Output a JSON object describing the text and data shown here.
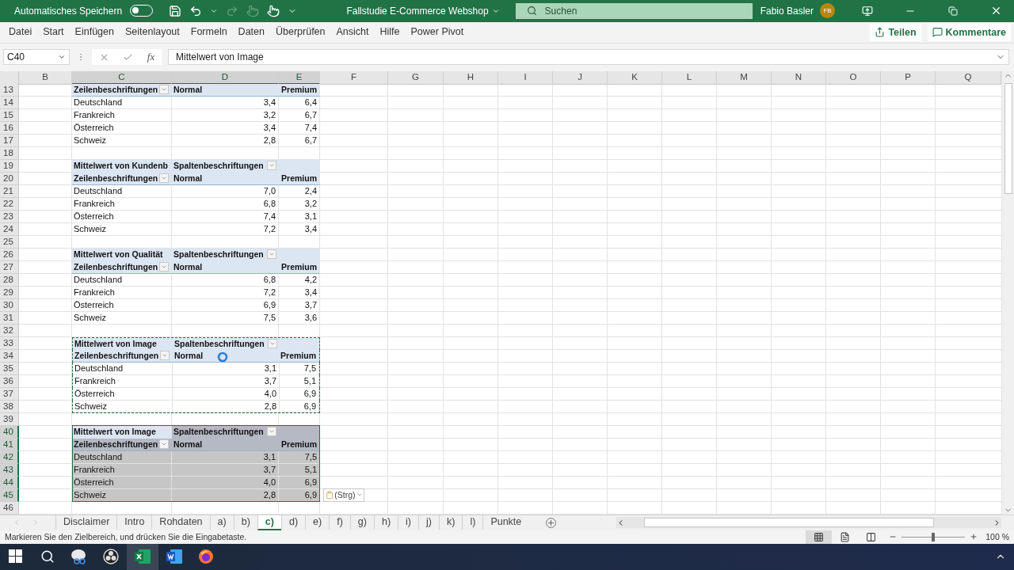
{
  "title_bar": {
    "autosave_label": "Automatisches Speichern",
    "autosave_on": false,
    "document_title": "Fallstudie E-Commerce Webshop",
    "search": {
      "placeholder": "Suchen"
    },
    "user_name": "Fabio Basler",
    "user_initials": "FB"
  },
  "ribbon_tabs": [
    {
      "label": "Datei",
      "selected": false
    },
    {
      "label": "Start",
      "selected": false
    },
    {
      "label": "Einfügen",
      "selected": false
    },
    {
      "label": "Seitenlayout",
      "selected": false
    },
    {
      "label": "Formeln",
      "selected": false
    },
    {
      "label": "Daten",
      "selected": false
    },
    {
      "label": "Überprüfen",
      "selected": false
    },
    {
      "label": "Ansicht",
      "selected": false
    },
    {
      "label": "Hilfe",
      "selected": false
    },
    {
      "label": "Power Pivot",
      "selected": false
    }
  ],
  "ribbon_buttons": [
    {
      "label": "Teilen",
      "kind": "share"
    },
    {
      "label": "Kommentare",
      "kind": "comments"
    }
  ],
  "formula_bar": {
    "name_box": "C40",
    "function_label": "fx",
    "formula": "Mittelwert von Image"
  },
  "columns": [
    {
      "label": "B",
      "selected": false
    },
    {
      "label": "C",
      "selected": true
    },
    {
      "label": "D",
      "selected": true
    },
    {
      "label": "E",
      "selected": true
    },
    {
      "label": "F",
      "selected": false
    },
    {
      "label": "G",
      "selected": false
    },
    {
      "label": "H",
      "selected": false
    },
    {
      "label": "I",
      "selected": false
    },
    {
      "label": "J",
      "selected": false
    },
    {
      "label": "K",
      "selected": false
    },
    {
      "label": "L",
      "selected": false
    },
    {
      "label": "M",
      "selected": false
    },
    {
      "label": "N",
      "selected": false
    },
    {
      "label": "O",
      "selected": false
    },
    {
      "label": "P",
      "selected": false
    },
    {
      "label": "Q",
      "selected": false
    }
  ],
  "rows": [
    {
      "number": "13",
      "kind": "header",
      "cells": [
        "Zeilenbeschriftungen",
        "Normal",
        "Premium"
      ],
      "copied": false,
      "selected": false,
      "active": false
    },
    {
      "number": "14",
      "kind": "data",
      "cells": [
        "Deutschland",
        "3,4",
        "6,4"
      ],
      "copied": false,
      "selected": false,
      "active": false
    },
    {
      "number": "15",
      "kind": "data",
      "cells": [
        "Frankreich",
        "3,2",
        "6,7"
      ],
      "copied": false,
      "selected": false,
      "active": false
    },
    {
      "number": "16",
      "kind": "data",
      "cells": [
        "Österreich",
        "3,4",
        "7,4"
      ],
      "copied": false,
      "selected": false,
      "active": false
    },
    {
      "number": "17",
      "kind": "data",
      "cells": [
        "Schweiz",
        "2,8",
        "6,7"
      ],
      "copied": false,
      "selected": false,
      "active": false
    },
    {
      "number": "18",
      "kind": "blank",
      "copied": false,
      "selected": false,
      "active": false
    },
    {
      "number": "19",
      "kind": "title",
      "cells": [
        "Mittelwert von Kundenb",
        "Spaltenbeschriftungen"
      ],
      "copied": false,
      "selected": false,
      "active": false
    },
    {
      "number": "20",
      "kind": "header",
      "cells": [
        "Zeilenbeschriftungen",
        "Normal",
        "Premium"
      ],
      "copied": false,
      "selected": false,
      "active": false
    },
    {
      "number": "21",
      "kind": "data",
      "cells": [
        "Deutschland",
        "7,0",
        "2,4"
      ],
      "copied": false,
      "selected": false,
      "active": false
    },
    {
      "number": "22",
      "kind": "data",
      "cells": [
        "Frankreich",
        "6,8",
        "3,2"
      ],
      "copied": false,
      "selected": false,
      "active": false
    },
    {
      "number": "23",
      "kind": "data",
      "cells": [
        "Österreich",
        "7,4",
        "3,1"
      ],
      "copied": false,
      "selected": false,
      "active": false
    },
    {
      "number": "24",
      "kind": "data",
      "cells": [
        "Schweiz",
        "7,2",
        "3,4"
      ],
      "copied": false,
      "selected": false,
      "active": false
    },
    {
      "number": "25",
      "kind": "blank",
      "copied": false,
      "selected": false,
      "active": false
    },
    {
      "number": "26",
      "kind": "title",
      "cells": [
        "Mittelwert von Qualität",
        "Spaltenbeschriftungen"
      ],
      "copied": false,
      "selected": false,
      "active": false
    },
    {
      "number": "27",
      "kind": "header",
      "cells": [
        "Zeilenbeschriftungen",
        "Normal",
        "Premium"
      ],
      "copied": false,
      "selected": false,
      "active": false
    },
    {
      "number": "28",
      "kind": "data",
      "cells": [
        "Deutschland",
        "6,8",
        "4,2"
      ],
      "copied": false,
      "selected": false,
      "active": false
    },
    {
      "number": "29",
      "kind": "data",
      "cells": [
        "Frankreich",
        "7,2",
        "3,4"
      ],
      "copied": false,
      "selected": false,
      "active": false
    },
    {
      "number": "30",
      "kind": "data",
      "cells": [
        "Österreich",
        "6,9",
        "3,7"
      ],
      "copied": false,
      "selected": false,
      "active": false
    },
    {
      "number": "31",
      "kind": "data",
      "cells": [
        "Schweiz",
        "7,5",
        "3,6"
      ],
      "copied": false,
      "selected": false,
      "active": false
    },
    {
      "number": "32",
      "kind": "blank",
      "copied": false,
      "selected": false,
      "active": false
    },
    {
      "number": "33",
      "kind": "title",
      "cells": [
        "Mittelwert von Image",
        "Spaltenbeschriftungen"
      ],
      "copied": true,
      "selected": false,
      "active": false
    },
    {
      "number": "34",
      "kind": "header",
      "cells": [
        "Zeilenbeschriftungen",
        "Normal",
        "Premium"
      ],
      "copied": true,
      "selected": false,
      "active": false
    },
    {
      "number": "35",
      "kind": "data",
      "cells": [
        "Deutschland",
        "3,1",
        "7,5"
      ],
      "copied": true,
      "selected": false,
      "active": false
    },
    {
      "number": "36",
      "kind": "data",
      "cells": [
        "Frankreich",
        "3,7",
        "5,1"
      ],
      "copied": true,
      "selected": false,
      "active": false
    },
    {
      "number": "37",
      "kind": "data",
      "cells": [
        "Österreich",
        "4,0",
        "6,9"
      ],
      "copied": true,
      "selected": false,
      "active": false
    },
    {
      "number": "38",
      "kind": "data",
      "cells": [
        "Schweiz",
        "2,8",
        "6,9"
      ],
      "copied": true,
      "selected": false,
      "active": false
    },
    {
      "number": "39",
      "kind": "blank",
      "copied": false,
      "selected": false,
      "active": false
    },
    {
      "number": "40",
      "kind": "title",
      "cells": [
        "Mittelwert von Image",
        "Spaltenbeschriftungen"
      ],
      "copied": false,
      "selected": true,
      "active": true
    },
    {
      "number": "41",
      "kind": "header",
      "cells": [
        "Zeilenbeschriftungen",
        "Normal",
        "Premium"
      ],
      "copied": false,
      "selected": true,
      "active": false
    },
    {
      "number": "42",
      "kind": "data",
      "cells": [
        "Deutschland",
        "3,1",
        "7,5"
      ],
      "copied": false,
      "selected": true,
      "active": false
    },
    {
      "number": "43",
      "kind": "data",
      "cells": [
        "Frankreich",
        "3,7",
        "5,1"
      ],
      "copied": false,
      "selected": true,
      "active": false
    },
    {
      "number": "44",
      "kind": "data",
      "cells": [
        "Österreich",
        "4,0",
        "6,9"
      ],
      "copied": false,
      "selected": true,
      "active": false
    },
    {
      "number": "45",
      "kind": "data",
      "cells": [
        "Schweiz",
        "2,8",
        "6,9"
      ],
      "copied": false,
      "selected": true,
      "active": false
    },
    {
      "number": "46",
      "kind": "blank",
      "copied": false,
      "selected": false,
      "active": false
    }
  ],
  "paste_options": {
    "label": "(Strg)"
  },
  "sheet_tabs": [
    {
      "label": "Disclaimer",
      "selected": false
    },
    {
      "label": "Intro",
      "selected": false
    },
    {
      "label": "Rohdaten",
      "selected": false
    },
    {
      "label": "a)",
      "selected": false
    },
    {
      "label": "b)",
      "selected": false
    },
    {
      "label": "c)",
      "selected": true
    },
    {
      "label": "d)",
      "selected": false
    },
    {
      "label": "e)",
      "selected": false
    },
    {
      "label": "f)",
      "selected": false
    },
    {
      "label": "g)",
      "selected": false
    },
    {
      "label": "h)",
      "selected": false
    },
    {
      "label": "i)",
      "selected": false
    },
    {
      "label": "j)",
      "selected": false
    },
    {
      "label": "k)",
      "selected": false
    },
    {
      "label": "l)",
      "selected": false
    },
    {
      "label": "Punkte",
      "selected": false
    }
  ],
  "status_bar": {
    "message": "Markieren Sie den Zielbereich, und drücken Sie die Eingabetaste.",
    "zoom": "100 %",
    "zoom_slider": {
      "level": 0.5
    },
    "views": [
      {
        "kind": "normal",
        "selected": true
      },
      {
        "kind": "page_layout",
        "selected": false
      },
      {
        "kind": "page_break",
        "selected": false
      }
    ]
  },
  "taskbar": {
    "apps": [
      {
        "kind": "start",
        "selected": false
      },
      {
        "kind": "search",
        "selected": false
      },
      {
        "kind": "snip",
        "selected": false
      },
      {
        "kind": "obs",
        "selected": false
      },
      {
        "kind": "excel",
        "selected": true
      },
      {
        "kind": "word",
        "selected": false
      },
      {
        "kind": "firefox",
        "selected": false
      }
    ]
  }
}
